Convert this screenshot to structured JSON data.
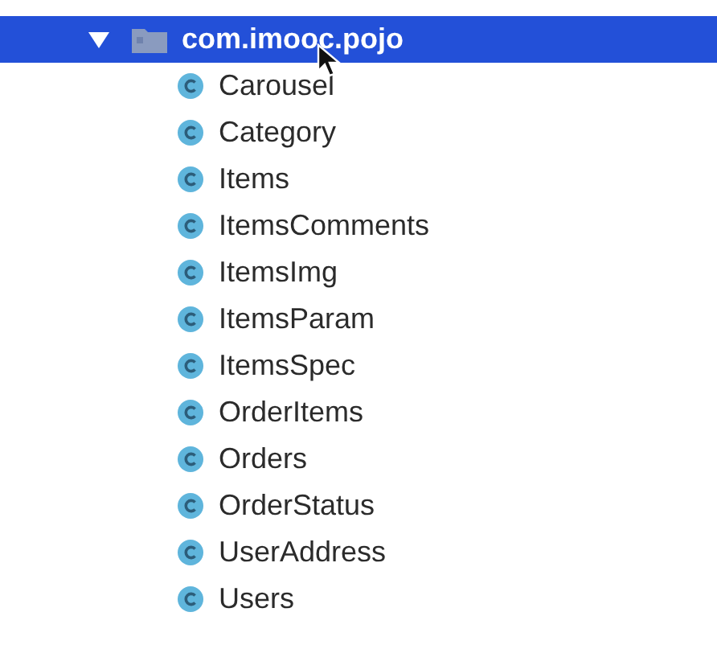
{
  "tree": [
    {
      "label": "com.imooc.pojo",
      "kind": "package",
      "expanded": true,
      "selected": true,
      "children": [
        {
          "label": "Carousel",
          "kind": "class",
          "selected": false
        },
        {
          "label": "Category",
          "kind": "class",
          "selected": false
        },
        {
          "label": "Items",
          "kind": "class",
          "selected": false
        },
        {
          "label": "ItemsComments",
          "kind": "class",
          "selected": false
        },
        {
          "label": "ItemsImg",
          "kind": "class",
          "selected": false
        },
        {
          "label": "ItemsParam",
          "kind": "class",
          "selected": false
        },
        {
          "label": "ItemsSpec",
          "kind": "class",
          "selected": false
        },
        {
          "label": "OrderItems",
          "kind": "class",
          "selected": false
        },
        {
          "label": "Orders",
          "kind": "class",
          "selected": false
        },
        {
          "label": "OrderStatus",
          "kind": "class",
          "selected": false
        },
        {
          "label": "UserAddress",
          "kind": "class",
          "selected": false
        },
        {
          "label": "Users",
          "kind": "class",
          "selected": false
        }
      ]
    }
  ]
}
